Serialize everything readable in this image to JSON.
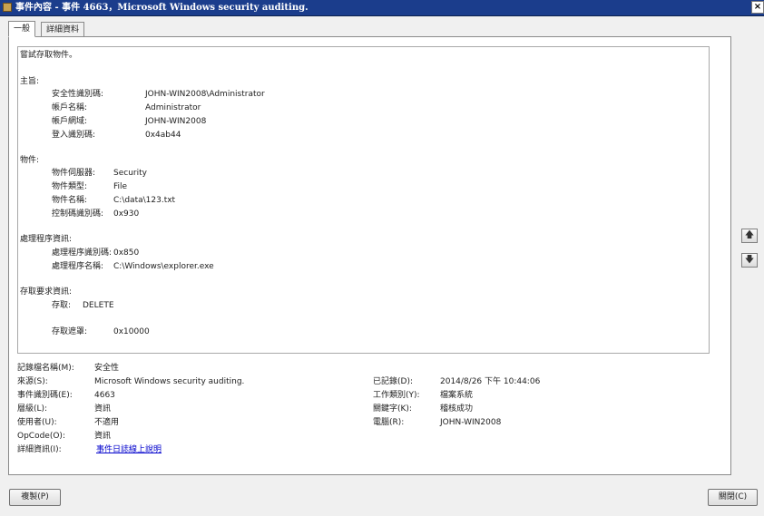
{
  "window": {
    "title": "事件內容 - 事件 4663，Microsoft Windows security auditing.",
    "close_glyph": "×"
  },
  "tabs": [
    {
      "label": "一般"
    },
    {
      "label": "詳細資料"
    }
  ],
  "description": {
    "intro": "嘗試存取物件。",
    "subject_heading": "主旨:",
    "subject": [
      {
        "label": "安全性識別碼:",
        "value": "JOHN-WIN2008\\Administrator"
      },
      {
        "label": "帳戶名稱:",
        "value": "Administrator"
      },
      {
        "label": "帳戶網域:",
        "value": "JOHN-WIN2008"
      },
      {
        "label": "登入識別碼:",
        "value": "0x4ab44"
      }
    ],
    "object_heading": "物件:",
    "object": [
      {
        "label": "物件伺服器:",
        "value": "Security"
      },
      {
        "label": "物件類型:",
        "value": "File"
      },
      {
        "label": "物件名稱:",
        "value": "C:\\data\\123.txt"
      },
      {
        "label": "控制碼識別碼:",
        "value": "0x930"
      }
    ],
    "process_heading": "處理程序資訊:",
    "process": [
      {
        "label": "處理程序識別碼:",
        "value": "0x850"
      },
      {
        "label": "處理程序名稱:",
        "value": "C:\\Windows\\explorer.exe"
      }
    ],
    "access_heading": "存取要求資訊:",
    "access": {
      "label": "存取:",
      "value": "DELETE"
    },
    "mask": {
      "label": "存取遮罩:",
      "value": "0x10000"
    }
  },
  "fields": {
    "log_name": {
      "label": "記錄檔名稱(M):",
      "value": "安全性"
    },
    "source": {
      "label": "來源(S):",
      "value": "Microsoft Windows security auditing."
    },
    "event_id": {
      "label": "事件識別碼(E):",
      "value": "4663"
    },
    "level": {
      "label": "層級(L):",
      "value": "資訊"
    },
    "user": {
      "label": "使用者(U):",
      "value": "不適用"
    },
    "opcode": {
      "label": "OpCode(O):",
      "value": "資訊"
    },
    "more_info": {
      "label": "詳細資訊(I):",
      "value": "事件日誌線上說明"
    },
    "logged": {
      "label": "已記錄(D):",
      "value": "2014/8/26 下午 10:44:06"
    },
    "task_category": {
      "label": "工作類別(Y):",
      "value": "檔案系統"
    },
    "keywords": {
      "label": "關鍵字(K):",
      "value": "稽核成功"
    },
    "computer": {
      "label": "電腦(R):",
      "value": "JOHN-WIN2008"
    }
  },
  "buttons": {
    "copy": "複製(P)",
    "close": "關閉(C)",
    "up_glyph": "🡅",
    "down_glyph": "🡇"
  },
  "colors": {
    "titlebar": "#1b3d8c",
    "link": "#0000cc"
  }
}
